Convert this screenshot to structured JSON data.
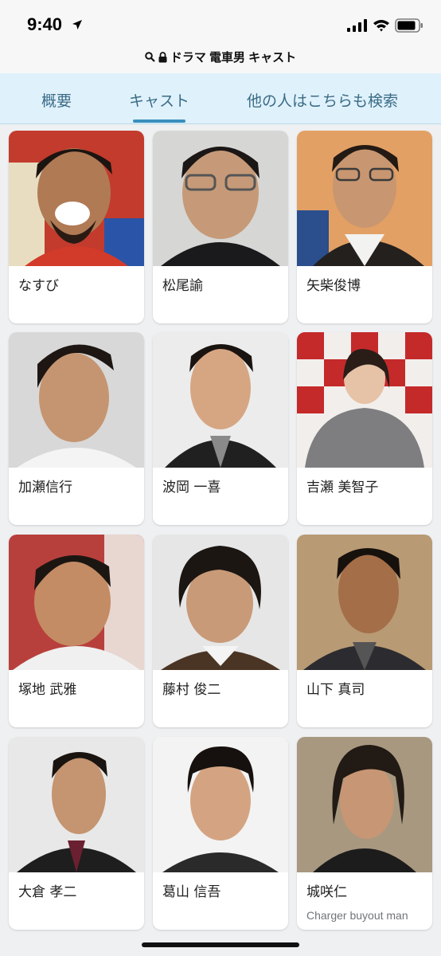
{
  "status_bar": {
    "time": "9:40"
  },
  "url_bar": {
    "title": "ドラマ 電車男 キャスト"
  },
  "tabs": [
    {
      "label": "概要",
      "selected": false
    },
    {
      "label": "キャスト",
      "selected": true
    },
    {
      "label": "他の人はこちらも検索",
      "selected": false
    }
  ],
  "accent_color": "#3a8fbe",
  "cast": [
    {
      "name": "なすび"
    },
    {
      "name": "松尾諭"
    },
    {
      "name": "矢柴俊博"
    },
    {
      "name": "加瀬信行"
    },
    {
      "name": "波岡 一喜"
    },
    {
      "name": "吉瀬 美智子"
    },
    {
      "name": "塚地 武雅"
    },
    {
      "name": "藤村 俊二"
    },
    {
      "name": "山下 真司"
    },
    {
      "name": "大倉 孝二"
    },
    {
      "name": "葛山 信吾"
    },
    {
      "name": "城咲仁",
      "role": "Charger buyout man"
    }
  ]
}
